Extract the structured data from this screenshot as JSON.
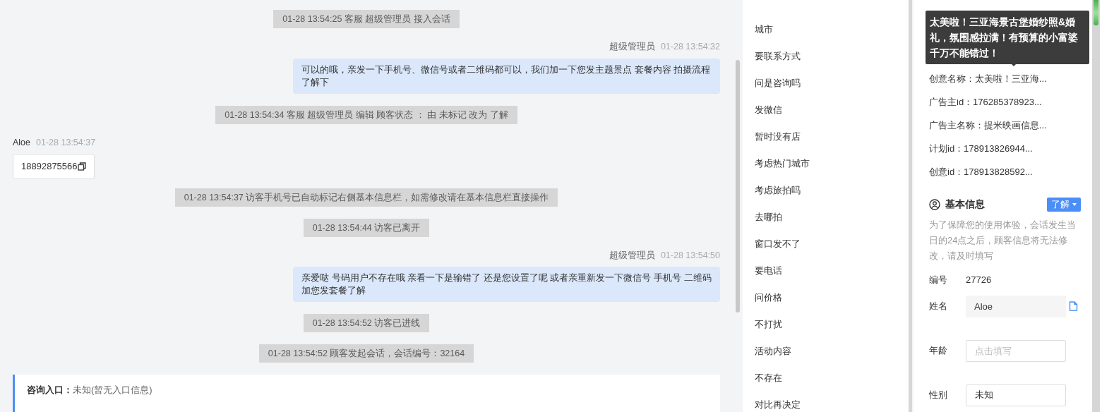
{
  "chat": {
    "messages": [
      {
        "kind": "system",
        "text": "01-28 13:54:25 客服 超级管理员 接入会话"
      },
      {
        "kind": "agent",
        "sender": "超级管理员",
        "time": "01-28 13:54:32",
        "text": "可以的哦，亲发一下手机号、微信号或者二维码都可以，我们加一下您发主题景点 套餐内容 拍摄流程了解下"
      },
      {
        "kind": "system",
        "text": "01-28 13:54:34 客服 超级管理员 编辑 顾客状态 ： 由 未标记 改为 了解"
      },
      {
        "kind": "visitor",
        "sender": "Aloe",
        "time": "01-28 13:54:37",
        "text": "18892875566"
      },
      {
        "kind": "system",
        "text": "01-28 13:54:37 访客手机号已自动标记右侧基本信息栏，如需修改请在基本信息栏直接操作"
      },
      {
        "kind": "system",
        "text": "01-28 13:54:44 访客已离开"
      },
      {
        "kind": "agent",
        "sender": "超级管理员",
        "time": "01-28 13:54:50",
        "text": "亲爱哒 号码用户不存在哦 亲看一下是输错了 还是您设置了呢 或者亲重新发一下微信号 手机号 二维码加您发套餐了解"
      },
      {
        "kind": "system",
        "text": "01-28 13:54:52 访客已进线"
      },
      {
        "kind": "system",
        "text": "01-28 13:54:52 顾客发起会话，会话编号：32164"
      },
      {
        "kind": "source",
        "rows": [
          {
            "label": "咨询入口：",
            "value": "未知(暂无入口信息)"
          }
        ]
      }
    ]
  },
  "quick_replies": [
    "城市",
    "要联系方式",
    "问是咨询吗",
    "发微信",
    "暂时没有店",
    "考虑热门城市",
    "考虑旅拍吗",
    "去哪拍",
    "窗口发不了",
    "要电话",
    "问价格",
    "不打扰",
    "活动内容",
    "不存在",
    "对比再决定"
  ],
  "ad_info": [
    {
      "label": "创意名称：",
      "value": "太美啦！三亚海..."
    },
    {
      "label": "广告主id：",
      "value": "176285378923..."
    },
    {
      "label": "广告主名称：",
      "value": "提米映画信息..."
    },
    {
      "label": "计划id：",
      "value": "178913826944..."
    },
    {
      "label": "创意id：",
      "value": "178913828592..."
    }
  ],
  "tooltip": "太美啦！三亚海景古堡婚纱照&婚礼，氛围感拉满！有预算的小富婆千万不能错过！",
  "basic_info": {
    "title": "基本信息",
    "status_button": "了解",
    "note": "为了保障您的使用体验，会话发生当日的24点之后，顾客信息将无法修改，请及时填写",
    "fields": [
      {
        "label": "编号",
        "kind": "text",
        "value": "27726"
      },
      {
        "label": "姓名",
        "kind": "copy",
        "value": "Aloe"
      },
      {
        "label": "年龄",
        "kind": "input",
        "placeholder": "点击填写"
      },
      {
        "label": "性别",
        "kind": "input",
        "value": "未知"
      }
    ]
  }
}
